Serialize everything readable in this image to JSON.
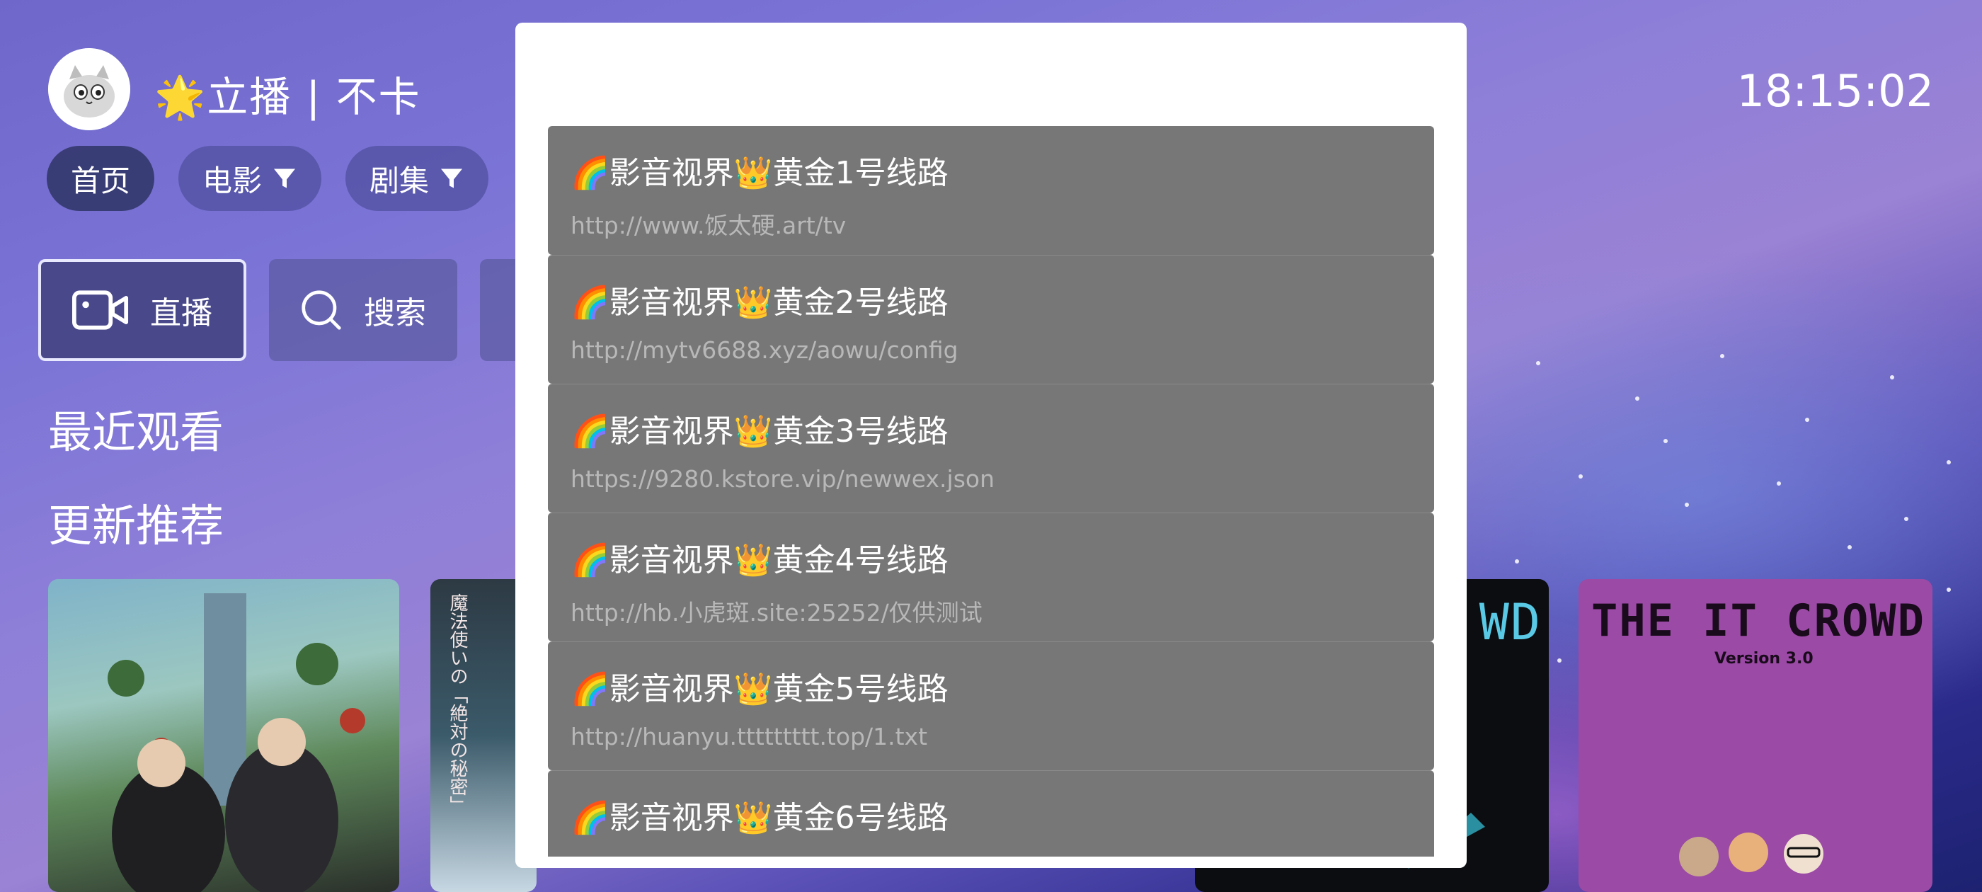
{
  "header": {
    "app_title": "🌟立播 | 不卡",
    "clock": "18:15:02"
  },
  "tabs": [
    {
      "label": "首页",
      "has_filter": false
    },
    {
      "label": "电影",
      "has_filter": true
    },
    {
      "label": "剧集",
      "has_filter": true
    }
  ],
  "quick_actions": [
    {
      "label": "直播",
      "icon": "video-camera-icon"
    },
    {
      "label": "搜索",
      "icon": "search-icon"
    }
  ],
  "sections": {
    "recent": "最近观看",
    "recommend": "更新推荐"
  },
  "posters": {
    "poster4_text": "THE IT CROWD",
    "poster4_subtext": "Version 3.0",
    "poster2_text": "魔法使いの「絶対の秘密」"
  },
  "source_dialog": {
    "items": [
      {
        "title": "🌈影音视界👑黄金1号线路",
        "url": "http://www.饭太硬.art/tv"
      },
      {
        "title": "🌈影音视界👑黄金2号线路",
        "url": "http://mytv6688.xyz/aowu/config"
      },
      {
        "title": "🌈影音视界👑黄金3号线路",
        "url": "https://9280.kstore.vip/newwex.json"
      },
      {
        "title": "🌈影音视界👑黄金4号线路",
        "url": "http://hb.小虎斑.site:25252/仅供测试"
      },
      {
        "title": "🌈影音视界👑黄金5号线路",
        "url": "http://huanyu.ttttttttt.top/1.txt"
      },
      {
        "title": "🌈影音视界👑黄金6号线路",
        "url": ""
      }
    ]
  },
  "colors": {
    "modal_bg": "#ffffff",
    "item_bg": "#777777",
    "url_text": "#b8b8b8"
  }
}
